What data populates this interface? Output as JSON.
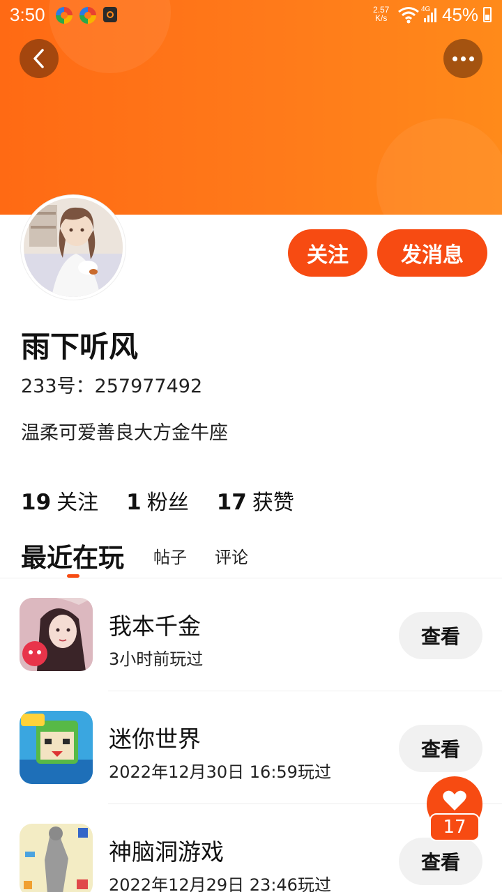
{
  "status_bar": {
    "time": "3:50",
    "net_speed_top": "2.57",
    "net_speed_bottom": "K/s",
    "network_type": "4G",
    "battery": "45%"
  },
  "header": {
    "back_icon": "chevron-left-icon",
    "more_icon": "more-dots-icon",
    "accent_color": "#ff7a1a"
  },
  "profile": {
    "name": "雨下听风",
    "uid": "233号：257977492",
    "bio": "温柔可爱善良大方金牛座",
    "follow_label": "关注",
    "message_label": "发消息"
  },
  "stats": [
    {
      "value": "19",
      "label": "关注"
    },
    {
      "value": "1",
      "label": "粉丝"
    },
    {
      "value": "17",
      "label": "获赞"
    }
  ],
  "tabs": {
    "active": "最近在玩",
    "posts": "帖子",
    "comments": "评论"
  },
  "games": [
    {
      "title": "我本千金",
      "played": "3小时前玩过",
      "action": "查看"
    },
    {
      "title": "迷你世界",
      "played": "2022年12月30日 16:59玩过",
      "action": "查看"
    },
    {
      "title": "神脑洞游戏",
      "played": "2022年12月29日 23:46玩过",
      "action": "查看"
    }
  ],
  "like_fab": {
    "count": "17",
    "icon": "heart-icon"
  }
}
